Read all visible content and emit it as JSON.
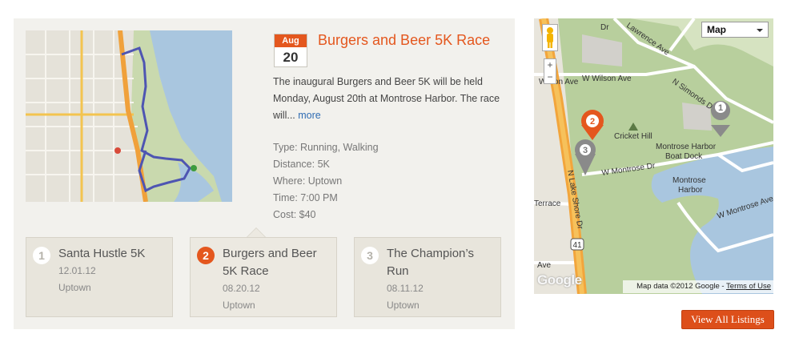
{
  "featured": {
    "date_month": "Aug",
    "date_day": "20",
    "title": "Burgers and Beer 5K Race",
    "description": "The inaugural Burgers and Beer 5K will be held Monday, August 20th at Montrose Harbor. The race will...",
    "more_label": "more",
    "facts": [
      "Type: Running, Walking",
      "Distance: 5K",
      "Where: Uptown",
      "Time: 7:00 PM",
      "Cost: $40"
    ]
  },
  "cards": [
    {
      "number": "1",
      "title": "Santa Hustle 5K",
      "date": "12.01.12",
      "location": "Uptown",
      "active": false
    },
    {
      "number": "2",
      "title": "Burgers and Beer 5K Race",
      "date": "08.20.12",
      "location": "Uptown",
      "active": true
    },
    {
      "number": "3",
      "title": "The Champion’s Run",
      "date": "08.11.12",
      "location": "Uptown",
      "active": false
    }
  ],
  "map": {
    "type_select": "Map",
    "zoom_in": "+",
    "zoom_out": "−",
    "attribution": "Map data ©2012 Google - ",
    "terms": "Terms of Use",
    "logo": "Google",
    "labels": {
      "wilson_ave": "Wilson Ave",
      "w_wilson_ave": "W Wilson Ave",
      "n_simonds": "N Simonds Dr",
      "lawrence_ave": "Lawrence Ave",
      "cricket_hill": "Cricket Hill",
      "boat_dock_1": "Montrose Harbor",
      "boat_dock_2": "Boat Dock",
      "w_montrose": "W Montrose Dr",
      "harbor_1": "Montrose",
      "harbor_2": "Harbor",
      "lake_shore": "N Lake Shore Dr",
      "montrose_ave": "W Montrose Ave",
      "terrace": "Terrace",
      "ave": "Ave",
      "dr_partial": "Dr",
      "highway": "41"
    },
    "pins": [
      "1",
      "2",
      "3"
    ]
  },
  "view_all_label": "View All Listings"
}
